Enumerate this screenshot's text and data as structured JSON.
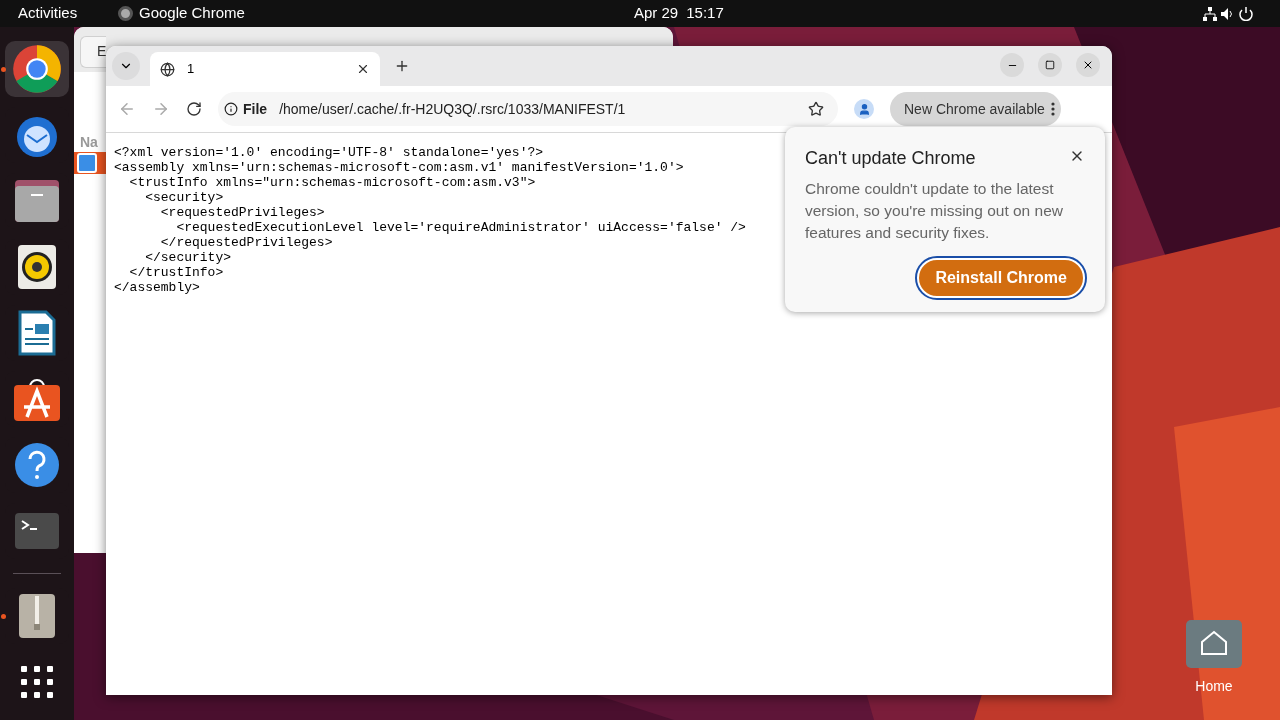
{
  "top_bar": {
    "activities": "Activities",
    "app_name": "Google Chrome",
    "date": "Apr 29",
    "time": "15:17"
  },
  "dock": {
    "favorites": [
      {
        "kind": "chrome",
        "running": true,
        "selected": true
      },
      {
        "kind": "mail",
        "running": false,
        "selected": false
      },
      {
        "kind": "files",
        "running": false,
        "selected": false
      },
      {
        "kind": "music",
        "running": false,
        "selected": false
      },
      {
        "kind": "writer",
        "running": false,
        "selected": false
      },
      {
        "kind": "store",
        "running": false,
        "selected": false
      },
      {
        "kind": "help",
        "running": false,
        "selected": false
      },
      {
        "kind": "terminal",
        "running": false,
        "selected": false
      }
    ],
    "others": [
      {
        "kind": "archive",
        "running": true,
        "selected": false
      }
    ]
  },
  "background_window": {
    "button_label": "E",
    "column_header": "Na"
  },
  "browser": {
    "tab": {
      "title": "1",
      "selected": true
    },
    "address": {
      "scheme": "File",
      "url": "/home/user/.cache/.fr-H2UQ3Q/.rsrc/1033/MANIFEST/1"
    },
    "update_chip": "New Chrome available",
    "content_lines": [
      "<?xml version='1.0' encoding='UTF-8' standalone='yes'?>",
      "<assembly xmlns='urn:schemas-microsoft-com:asm.v1' manifestVersion='1.0'>",
      "  <trustInfo xmlns=\"urn:schemas-microsoft-com:asm.v3\">",
      "    <security>",
      "      <requestedPrivileges>",
      "        <requestedExecutionLevel level='requireAdministrator' uiAccess='false' />",
      "      </requestedPrivileges>",
      "    </security>",
      "  </trustInfo>",
      "</assembly>"
    ],
    "popup": {
      "title": "Can't update Chrome",
      "body": "Chrome couldn't update to the latest version, so you're missing out on new features and security fixes.",
      "button": "Reinstall Chrome"
    }
  },
  "desktop_icons": [
    {
      "label": "Home"
    }
  ]
}
